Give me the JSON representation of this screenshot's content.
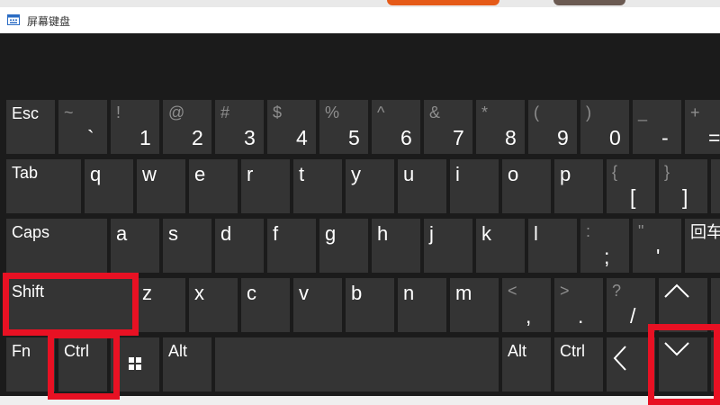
{
  "window": {
    "title": "屏幕键盘"
  },
  "colors": {
    "key": "#343434",
    "background": "#1b1b1b",
    "highlight": "#e81123"
  },
  "keys": {
    "esc": "Esc",
    "backtick": {
      "top": "~",
      "main": "`"
    },
    "k1": {
      "top": "!",
      "main": "1"
    },
    "k2": {
      "top": "@",
      "main": "2"
    },
    "k3": {
      "top": "#",
      "main": "3"
    },
    "k4": {
      "top": "$",
      "main": "4"
    },
    "k5": {
      "top": "%",
      "main": "5"
    },
    "k6": {
      "top": "^",
      "main": "6"
    },
    "k7": {
      "top": "&",
      "main": "7"
    },
    "k8": {
      "top": "*",
      "main": "8"
    },
    "k9": {
      "top": "(",
      "main": "9"
    },
    "k0": {
      "top": ")",
      "main": "0"
    },
    "minus": {
      "top": "_",
      "main": "-"
    },
    "equals": {
      "top": "+",
      "main": "="
    },
    "tab": "Tab",
    "q": "q",
    "w": "w",
    "e": "e",
    "r": "r",
    "t": "t",
    "y": "y",
    "u": "u",
    "i": "i",
    "o": "o",
    "p": "p",
    "lbracket": {
      "top": "{",
      "main": "["
    },
    "rbracket": {
      "top": "}",
      "main": "]"
    },
    "caps": "Caps",
    "a": "a",
    "s": "s",
    "d": "d",
    "f": "f",
    "g": "g",
    "h": "h",
    "j": "j",
    "k": "k",
    "l": "l",
    "semicolon": {
      "top": ":",
      "main": ";"
    },
    "quote": {
      "top": "\"",
      "main": "'"
    },
    "enter": "回车",
    "shift": "Shift",
    "z": "z",
    "x": "x",
    "c": "c",
    "v": "v",
    "b": "b",
    "n": "n",
    "m": "m",
    "comma": {
      "top": "<",
      "main": ","
    },
    "period": {
      "top": ">",
      "main": "."
    },
    "slash": {
      "top": "?",
      "main": "/"
    },
    "fn": "Fn",
    "ctrl": "Ctrl",
    "alt": "Alt",
    "alt_right": "Alt",
    "ctrl_right": "Ctrl"
  }
}
